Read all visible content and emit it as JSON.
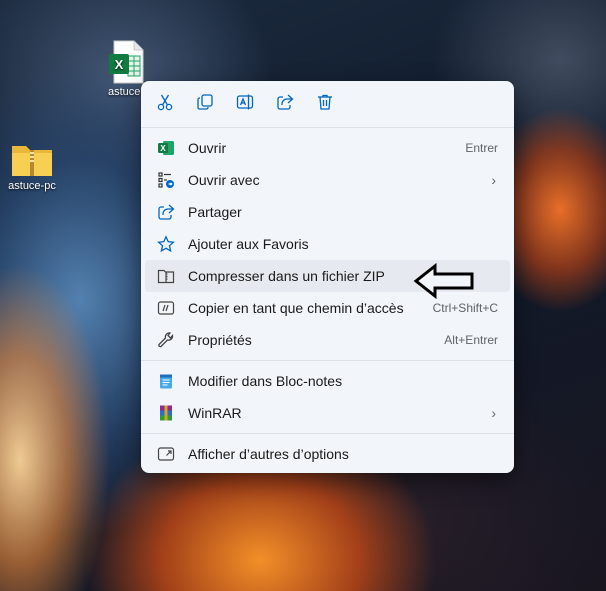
{
  "desktop": {
    "icons": [
      {
        "label": "astuce-",
        "kind": "excel-file"
      },
      {
        "label": "astuce-pc",
        "kind": "zip-folder"
      }
    ]
  },
  "context_menu": {
    "toolbar": [
      {
        "name": "cut-icon"
      },
      {
        "name": "copy-icon"
      },
      {
        "name": "rename-icon"
      },
      {
        "name": "share-icon"
      },
      {
        "name": "delete-icon"
      }
    ],
    "items": [
      {
        "label": "Ouvrir",
        "shortcut": "Entrer",
        "icon": "excel-icon"
      },
      {
        "label": "Ouvrir avec",
        "submenu": true,
        "icon": "open-with-icon"
      },
      {
        "label": "Partager",
        "icon": "share-icon"
      },
      {
        "label": "Ajouter aux Favoris",
        "icon": "star-icon"
      },
      {
        "label": "Compresser dans un fichier ZIP",
        "icon": "zip-icon",
        "highlighted": true
      },
      {
        "label": "Copier en tant que chemin d’accès",
        "shortcut": "Ctrl+Shift+C",
        "icon": "copy-path-icon"
      },
      {
        "label": "Propriétés",
        "shortcut": "Alt+Entrer",
        "icon": "wrench-icon"
      },
      {
        "label": "Modifier dans Bloc-notes",
        "icon": "notepad-icon"
      },
      {
        "label": "WinRAR",
        "submenu": true,
        "icon": "winrar-icon"
      },
      {
        "label": "Afficher d’autres d’options",
        "icon": "more-options-icon"
      }
    ],
    "accent": "#0067c0"
  },
  "annotation": {
    "icon": "left-arrow-icon"
  }
}
